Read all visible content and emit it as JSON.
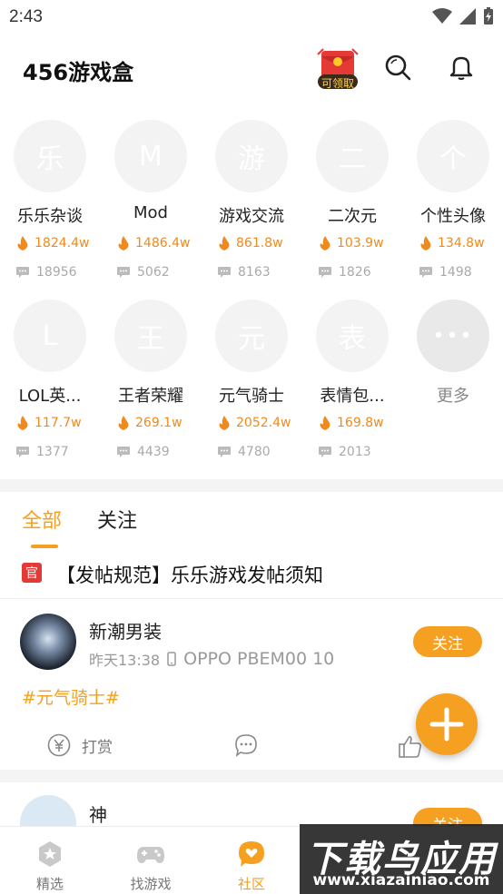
{
  "status_bar": {
    "time": "2:43"
  },
  "header": {
    "title": "456游戏盒",
    "redpacket_label": "可领取",
    "search_icon": "search-icon",
    "bell_icon": "bell-icon"
  },
  "forums": [
    {
      "avatar_char": "乐",
      "name": "乐乐杂谈",
      "heat": "1824.4w",
      "posts": "18956"
    },
    {
      "avatar_char": "M",
      "name": "Mod",
      "heat": "1486.4w",
      "posts": "5062"
    },
    {
      "avatar_char": "游",
      "name": "游戏交流",
      "heat": "861.8w",
      "posts": "8163"
    },
    {
      "avatar_char": "二",
      "name": "二次元",
      "heat": "103.9w",
      "posts": "1826"
    },
    {
      "avatar_char": "个",
      "name": "个性头像",
      "heat": "134.8w",
      "posts": "1498"
    },
    {
      "avatar_char": "L",
      "name": "LOL英...",
      "heat": "117.7w",
      "posts": "1377"
    },
    {
      "avatar_char": "王",
      "name": "王者荣耀",
      "heat": "269.1w",
      "posts": "4439"
    },
    {
      "avatar_char": "元",
      "name": "元气骑士",
      "heat": "2052.4w",
      "posts": "4780"
    },
    {
      "avatar_char": "表",
      "name": "表情包...",
      "heat": "169.8w",
      "posts": "2013"
    }
  ],
  "more": {
    "icon": "•••",
    "label": "更多"
  },
  "tabs": [
    {
      "label": "全部",
      "active": true
    },
    {
      "label": "关注",
      "active": false
    }
  ],
  "notice": {
    "badge": "官",
    "text": "【发帖规范】乐乐游戏发帖须知"
  },
  "post": {
    "author": "新潮男装",
    "time": "昨天13:38",
    "device": "OPPO PBEM00 10",
    "follow_label": "关注",
    "tag": "#元气骑士#",
    "reward_label": "打赏"
  },
  "post2": {
    "author": "神",
    "follow_label": "关注"
  },
  "bottom_nav": [
    {
      "label": "精选",
      "icon": "star-icon",
      "active": false
    },
    {
      "label": "找游戏",
      "icon": "gamepad-icon",
      "active": false
    },
    {
      "label": "社区",
      "icon": "chat-bubble-icon",
      "active": true
    }
  ],
  "watermark": {
    "main": "下载鸟应用",
    "sub": "www.xiazainiao.com"
  },
  "colors": {
    "accent": "#f5a020",
    "official": "#e53935",
    "heat": "#f08a1d"
  }
}
